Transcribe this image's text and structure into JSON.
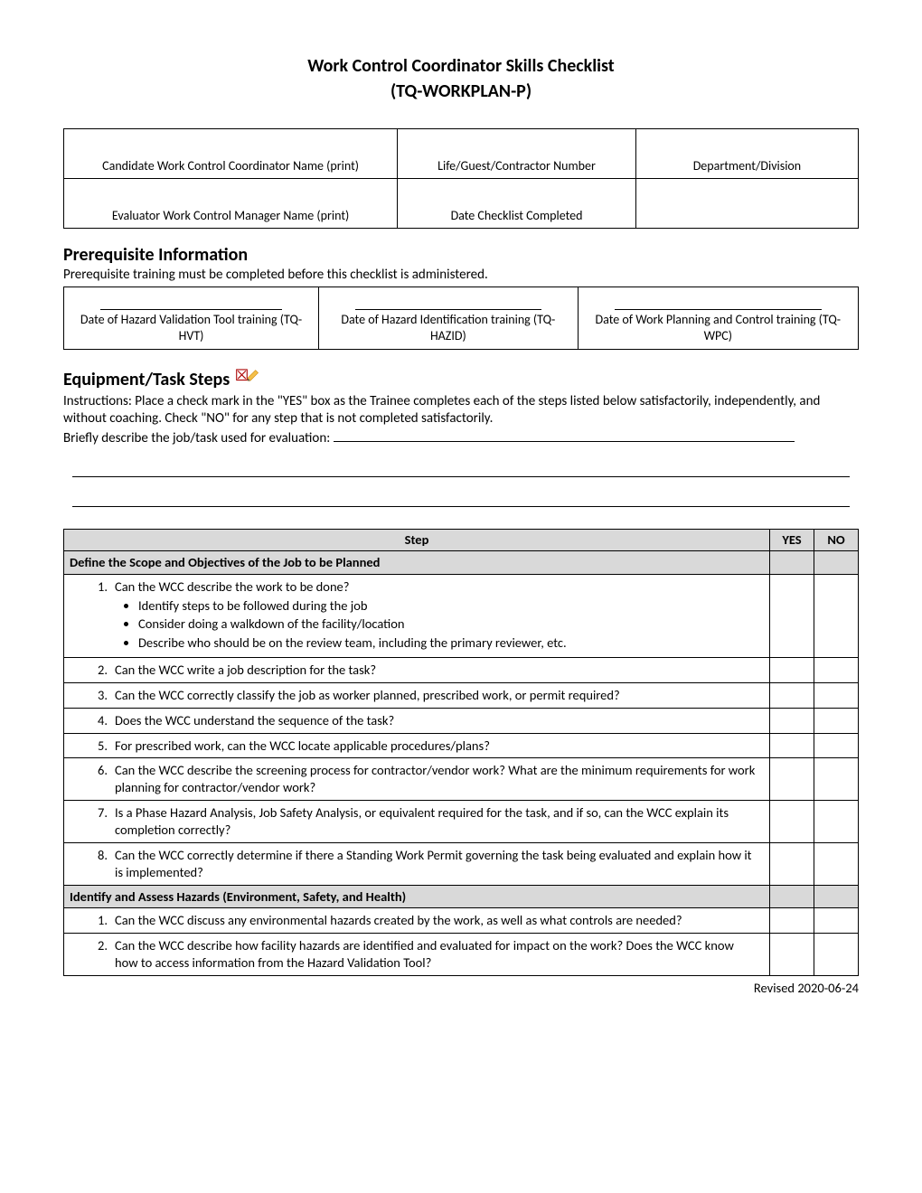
{
  "title": "Work Control Coordinator Skills Checklist",
  "subtitle": "(TQ-WORKPLAN-P)",
  "header_cells": [
    [
      "Candidate Work Control Coordinator Name (print)",
      "Life/Guest/Contractor Number",
      "Department/Division"
    ],
    [
      "Evaluator Work Control Manager Name (print)",
      "Date Checklist Completed",
      ""
    ]
  ],
  "prereq_heading": "Prerequisite Information",
  "prereq_sub": "Prerequisite training must be completed before this checklist is administered.",
  "prereq_cells": [
    "Date of Hazard Validation Tool training (TQ-HVT)",
    "Date of Hazard Identification training (TQ-HAZID)",
    "Date of Work Planning and Control training (TQ-WPC)"
  ],
  "equip_heading": "Equipment/Task Steps",
  "instructions_1": "Instructions:  Place a check mark in the \"YES\" box as the Trainee completes each of the steps listed below satisfactorily, independently, and without coaching.  Check \"NO\" for any step that is not completed satisfactorily.",
  "instructions_2": "Briefly describe the job/task used for evaluation:  ",
  "step_col": "Step",
  "yes_col": "YES",
  "no_col": "NO",
  "section_a": "Define the Scope and Objectives of the Job to be Planned",
  "sa": {
    "s1": "Can the WCC describe the work to be done?",
    "s1b1": "Identify steps to be followed during the job",
    "s1b2": "Consider doing a walkdown of the facility/location",
    "s1b3": "Describe who should be on the review team, including the primary reviewer, etc.",
    "s2": "Can the WCC write a job description for the task?",
    "s3": "Can the WCC correctly classify the job as worker planned, prescribed work, or permit required?",
    "s4": "Does the WCC understand the sequence of the task?",
    "s5": "For prescribed work, can the WCC locate applicable procedures/plans?",
    "s6": "Can the WCC describe the screening process for contractor/vendor work? What are the minimum requirements for work planning for contractor/vendor work?",
    "s7": "Is a Phase Hazard Analysis, Job Safety Analysis, or equivalent required for the task, and if so, can the WCC explain its completion correctly?",
    "s8": "Can the WCC correctly determine if there a Standing Work Permit governing the task being evaluated and explain how it is implemented?"
  },
  "section_b": "Identify and Assess Hazards (Environment, Safety, and Health)",
  "sb": {
    "s1": "Can the WCC discuss any environmental hazards created by the work, as well as what controls are needed?",
    "s2": "Can the WCC describe how facility hazards are identified and evaluated for impact on the work?  Does the WCC know how to access information from the Hazard Validation Tool?"
  },
  "footer": "Revised 2020-06-24"
}
